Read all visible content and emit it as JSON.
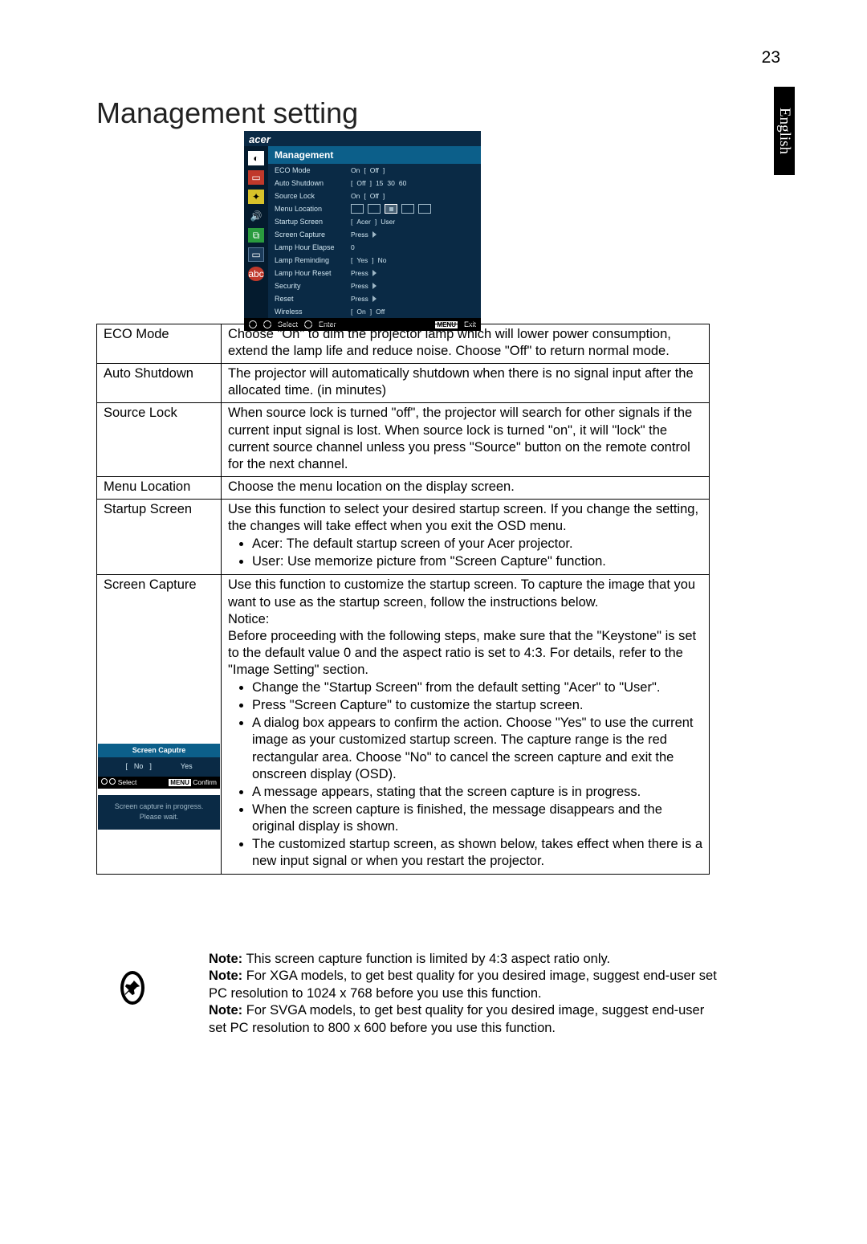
{
  "page_number": "23",
  "language": "English",
  "heading": "Management setting",
  "osd": {
    "logo": "acer",
    "title": "Management",
    "rows": {
      "eco_label": "ECO Mode",
      "eco_on": "On",
      "eco_off": "Off",
      "auto_label": "Auto Shutdown",
      "auto_off": "Off",
      "auto_15": "15",
      "auto_30": "30",
      "auto_60": "60",
      "source_label": "Source Lock",
      "source_on": "On",
      "source_off": "Off",
      "menu_loc_label": "Menu Location",
      "startup_label": "Startup Screen",
      "startup_acer": "Acer",
      "startup_user": "User",
      "capture_label": "Screen Capture",
      "capture_press": "Press",
      "elapse_label": "Lamp Hour Elapse",
      "elapse_val": "0",
      "remind_label": "Lamp Reminding",
      "remind_yes": "Yes",
      "remind_no": "No",
      "reset_label": "Lamp Hour Reset",
      "reset_press": "Press",
      "security_label": "Security",
      "security_press": "Press",
      "reset2_label": "Reset",
      "reset2_press": "Press",
      "wireless_label": "Wireless",
      "wireless_on": "On",
      "wireless_off": "Off"
    },
    "foot": {
      "select": "Select",
      "enter": "Enter",
      "menu": "MENU",
      "exit": "Exit"
    }
  },
  "table": {
    "r1_name": "ECO Mode",
    "r1_desc": "Choose \"On\" to dim the projector lamp which will lower power consumption, extend the lamp life and reduce noise.  Choose \"Off\" to return normal mode.",
    "r2_name": "Auto Shutdown",
    "r2_desc": "The projector will automatically shutdown when there is no signal input after the allocated time. (in minutes)",
    "r3_name": "Source Lock",
    "r3_desc": "When source lock is turned \"off\", the projector will search for other signals if the current input signal is lost. When source lock is turned \"on\", it will \"lock\" the current source channel unless you press \"Source\" button on the remote control for the next channel.",
    "r4_name": "Menu Location",
    "r4_desc": "Choose the menu location on the display screen.",
    "r5_name": "Startup Screen",
    "r5_desc_intro": "Use this function to select your desired startup screen. If you change the setting, the changes will take effect when you exit the OSD menu.",
    "r5_b1": "Acer: The default startup screen of your Acer projector.",
    "r5_b2": "User: Use memorize picture from \"Screen Capture\" function.",
    "r6_name": "Screen Capture",
    "r6_p1": "Use this function to customize the startup screen. To capture the image that you want to use as the startup screen, follow the instructions below.",
    "r6_p2": "Notice:",
    "r6_p3": "Before proceeding with the following steps, make sure that the \"Keystone\" is set to the default value 0 and the aspect ratio is set to 4:3. For details, refer to the \"Image Setting\" section.",
    "r6_b1": "Change the \"Startup Screen\" from the default setting \"Acer\" to \"User\".",
    "r6_b2": "Press \"Screen Capture\" to customize the startup screen.",
    "r6_b3": "A dialog box appears to confirm the action. Choose \"Yes\" to use the current image as your customized startup screen. The capture range is the red rectangular area. Choose \"No\" to cancel the screen capture and exit the onscreen display (OSD).",
    "r6_b4": "A message appears, stating that the screen capture is in progress.",
    "r6_b5": "When the screen capture is finished, the message disappears and the original display is shown.",
    "r6_b6": "The customized startup screen, as shown below, takes effect when there is a new input signal or when you restart the projector.",
    "mini_capture": {
      "title": "Screen Caputre",
      "no": "No",
      "yes": "Yes",
      "select": "Select",
      "menu": "MENU",
      "confirm": "Confirm"
    },
    "mini_progress": {
      "line1": "Screen capture in progress.",
      "line2": "Please wait."
    }
  },
  "notes": {
    "n1a": "Note:",
    "n1b": " This screen capture function is limited by 4:3 aspect ratio only.",
    "n2a": "Note:",
    "n2b": " For XGA models, to get best quality for you desired image, suggest end-user set PC resolution to 1024 x 768 before you use this function.",
    "n3a": "Note:",
    "n3b": " For SVGA models, to get best quality for you desired image, suggest end-user set PC resolution to 800 x 600 before you use this function."
  }
}
